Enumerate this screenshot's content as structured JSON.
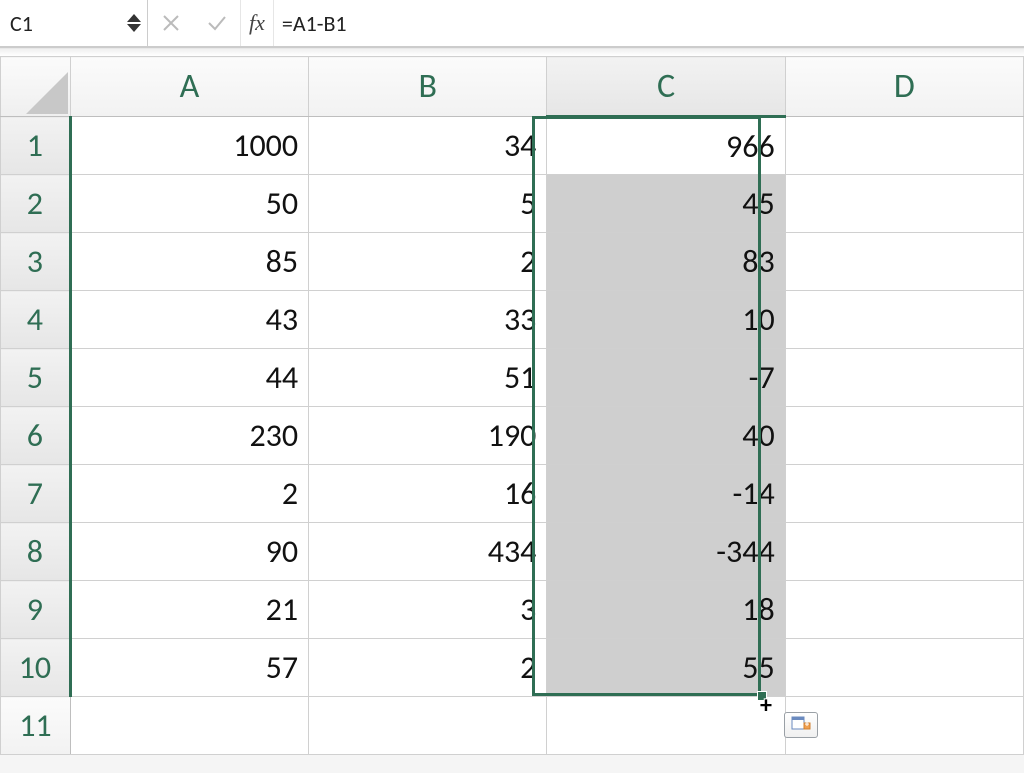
{
  "formula_bar": {
    "name_box": "C1",
    "fx_label": "fx",
    "formula": "=A1-B1"
  },
  "columns": [
    "A",
    "B",
    "C",
    "D"
  ],
  "row_numbers": [
    "1",
    "2",
    "3",
    "4",
    "5",
    "6",
    "7",
    "8",
    "9",
    "10",
    "11"
  ],
  "cells": {
    "A": [
      1000,
      50,
      85,
      43,
      44,
      230,
      2,
      90,
      21,
      57,
      ""
    ],
    "B": [
      34,
      5,
      2,
      33,
      51,
      190,
      16,
      434,
      3,
      2,
      ""
    ],
    "C": [
      966,
      45,
      83,
      10,
      -7,
      40,
      -14,
      -344,
      18,
      55,
      ""
    ],
    "D": [
      "",
      "",
      "",
      "",
      "",
      "",
      "",
      "",
      "",
      "",
      ""
    ]
  },
  "selection": {
    "active_cell": "C1",
    "range_start": "C1",
    "range_end": "C10",
    "col_index": 2,
    "row_start": 0,
    "row_end": 9
  },
  "colors": {
    "accent": "#2f6e54",
    "selection_fill": "#cfcfcf"
  }
}
